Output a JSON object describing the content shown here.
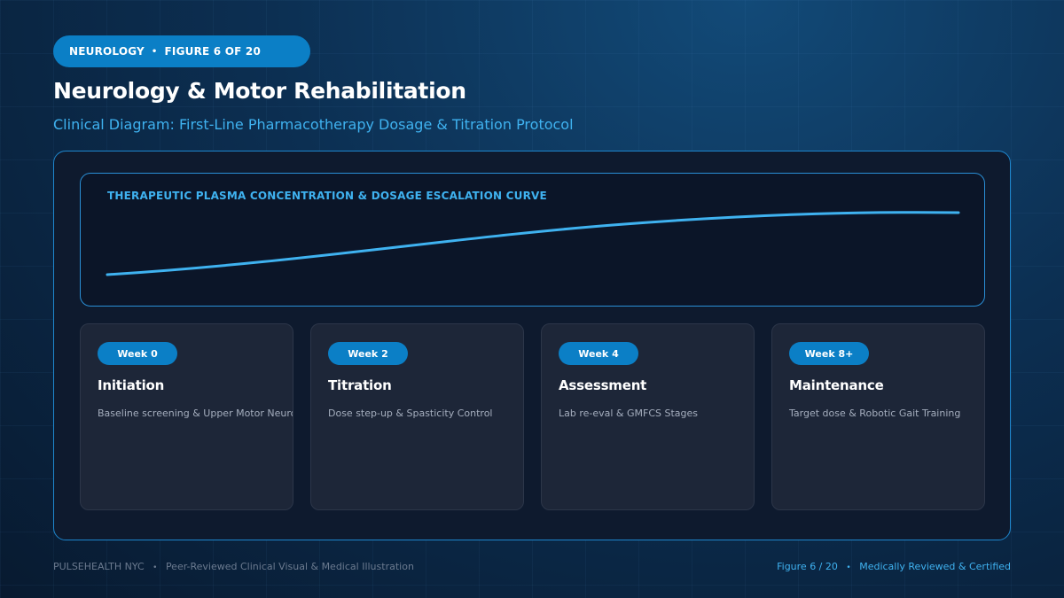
{
  "header": {
    "badge_section": "NEUROLOGY",
    "badge_separator": "•",
    "badge_figure": "FIGURE 6 OF 20",
    "title": "Neurology & Motor Rehabilitation",
    "subtitle": "Clinical Diagram: First-Line Pharmacotherapy Dosage & Titration Protocol"
  },
  "curve": {
    "label": "THERAPEUTIC PLASMA CONCENTRATION & DOSAGE ESCALATION CURVE",
    "color": "#3fb2f0"
  },
  "stages": [
    {
      "week": "Week 0",
      "title": "Initiation",
      "description": "Baseline screening & Upper Motor Neurons"
    },
    {
      "week": "Week 2",
      "title": "Titration",
      "description": "Dose step-up & Spasticity Control"
    },
    {
      "week": "Week 4",
      "title": "Assessment",
      "description": "Lab re-eval & GMFCS Stages"
    },
    {
      "week": "Week 8+",
      "title": "Maintenance",
      "description": "Target dose & Robotic Gait Training"
    }
  ],
  "footer": {
    "brand": "PULSEHEALTH NYC",
    "separator": "•",
    "tagline": "Peer-Reviewed Clinical Visual & Medical Illustration",
    "figure": "Figure 6 / 20",
    "certification": "Medically Reviewed & Certified"
  },
  "colors": {
    "accent": "#0b7fc6",
    "highlight": "#3fb2f0",
    "background": "#0c2f52",
    "card": "#1d2638"
  }
}
